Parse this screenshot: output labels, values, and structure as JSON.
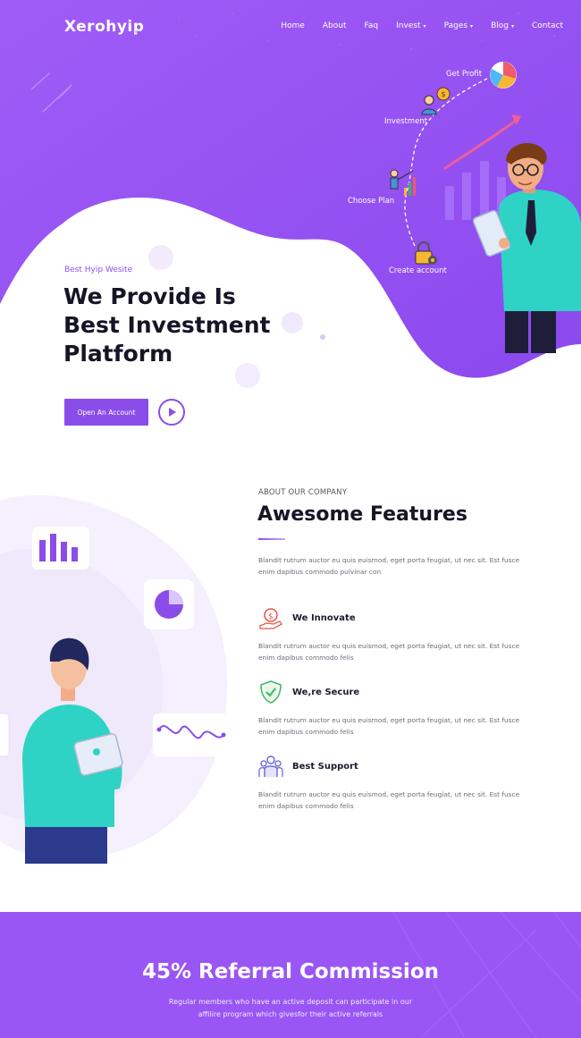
{
  "brand": {
    "name": "Xerohyip"
  },
  "nav": {
    "items": [
      {
        "label": "Home",
        "dropdown": false
      },
      {
        "label": "About",
        "dropdown": false
      },
      {
        "label": "Faq",
        "dropdown": false
      },
      {
        "label": "Invest",
        "dropdown": true
      },
      {
        "label": "Pages",
        "dropdown": true
      },
      {
        "label": "Blog",
        "dropdown": true
      },
      {
        "label": "Contact",
        "dropdown": false
      }
    ]
  },
  "hero": {
    "tagline": "Best Hyip Wesite",
    "title": "We Provide Is Best Investment Platform",
    "cta_label": "Open An Account",
    "steps": [
      "Get Profit",
      "Investment",
      "Choose Plan",
      "Create account"
    ]
  },
  "features": {
    "eyebrow": "ABOUT OUR COMPANY",
    "title": "Awesome Features",
    "intro": "Blandit rutrum auctor eu quis euismod, eget porta feugiat, ut nec sit. Est fusce enim dapibus commodo pulvinar con",
    "items": [
      {
        "title": "We Innovate",
        "text": "Blandit rutrum auctor eu quis euismod, eget porta feugiat, ut nec sit. Est fusce enim dapibus commodo felis",
        "icon": "money-hand-icon",
        "color": "#e8574a"
      },
      {
        "title": "We,re Secure",
        "text": "Blandit rutrum auctor eu quis euismod, eget porta feugiat, ut nec sit. Est fusce enim dapibus commodo felis",
        "icon": "shield-check-icon",
        "color": "#3cb85c"
      },
      {
        "title": "Best Support",
        "text": "Blandit rutrum auctor eu quis euismod, eget porta feugiat, ut nec sit. Est fusce enim dapibus commodo felis",
        "icon": "team-support-icon",
        "color": "#6a63d8"
      }
    ]
  },
  "referral": {
    "title": "45% Referral Commission",
    "description_line1": "Regular members who have an active deposit can participate in our",
    "description_line2": "affilire program which givesfor their active referrals"
  },
  "colors": {
    "primary": "#8a4de9",
    "hero_bg": "#9b57f5",
    "referral_bg": "#9a55f5"
  }
}
